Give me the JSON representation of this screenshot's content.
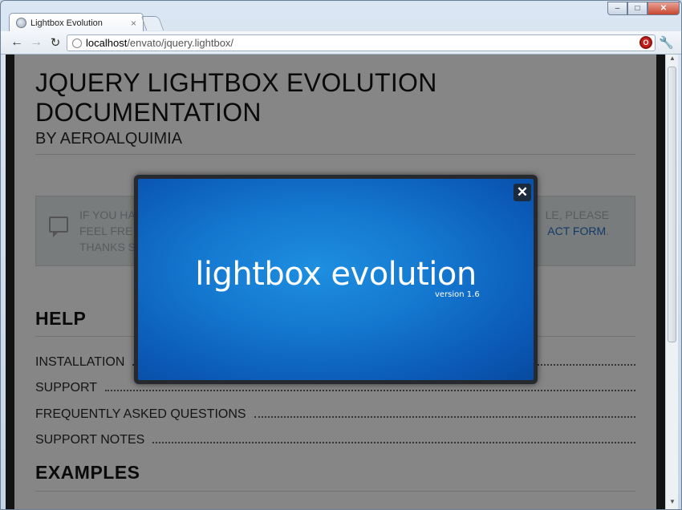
{
  "browser": {
    "tab_title": "Lightbox Evolution",
    "tab_close": "×",
    "url_host": "localhost",
    "url_path": "/envato/jquery.lightbox/",
    "window_min": "–",
    "window_max": "□",
    "window_close": "✕"
  },
  "page": {
    "title": "JQUERY LIGHTBOX EVOLUTION DOCUMENTATION",
    "subtitle": "BY AEROALQUIMIA",
    "notice_line1": "IF YOU HA",
    "notice_line1_end": "LE, PLEASE",
    "notice_line2": "FEEL FRE",
    "notice_link": "ACT FORM",
    "notice_line2_end": ".",
    "notice_line3": "THANKS S",
    "help_heading": "HELP",
    "help_items": [
      "INSTALLATION",
      "SUPPORT",
      "FREQUENTLY ASKED QUESTIONS",
      "SUPPORT NOTES"
    ],
    "examples_heading": "EXAMPLES"
  },
  "lightbox": {
    "logo_text": "lightbox evolution",
    "version_text": "version 1.6",
    "close_label": "✕"
  },
  "colors": {
    "lightbox_blue": "#1477cf",
    "page_bg": "#d9d9d9",
    "link": "#1d5ea8"
  }
}
